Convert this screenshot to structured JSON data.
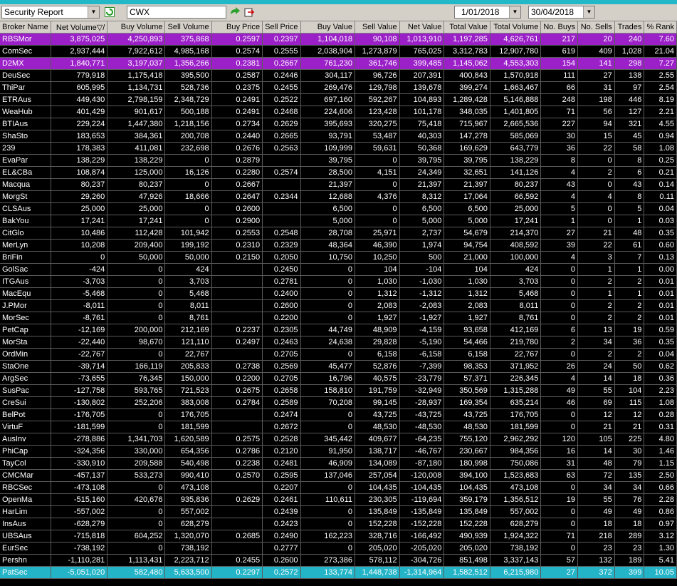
{
  "toolbar": {
    "report_select": "Security Report",
    "code_input": "CWX",
    "date_from": "1/01/2018",
    "date_to": "30/04/2018",
    "icons": [
      "refresh-icon",
      "go-arrow-icon",
      "export-icon"
    ]
  },
  "table": {
    "columns": [
      "Broker Name",
      "Net Volume",
      "Buy Volume",
      "Sell Volume",
      "Buy Price",
      "Sell Price",
      "Buy Value",
      "Sell Value",
      "Net Value",
      "Total Value",
      "Total Volume",
      "No. Buys",
      "No. Sells",
      "Trades",
      "% Rank"
    ],
    "sort_indicator": "▽/",
    "rows": [
      {
        "hl": "purple",
        "cells": [
          "RBSMor",
          "3,875,025",
          "4,250,893",
          "375,868",
          "0.2597",
          "0.2397",
          "1,104,018",
          "90,108",
          "1,013,910",
          "1,197,285",
          "4,626,761",
          "217",
          "20",
          "240",
          "7.60"
        ]
      },
      {
        "hl": "",
        "cells": [
          "ComSec",
          "2,937,444",
          "7,922,612",
          "4,985,168",
          "0.2574",
          "0.2555",
          "2,038,904",
          "1,273,879",
          "765,025",
          "3,312,783",
          "12,907,780",
          "619",
          "409",
          "1,028",
          "21.04"
        ]
      },
      {
        "hl": "purple",
        "cells": [
          "D2MX",
          "1,840,771",
          "3,197,037",
          "1,356,266",
          "0.2381",
          "0.2667",
          "761,230",
          "361,746",
          "399,485",
          "1,145,062",
          "4,553,303",
          "154",
          "141",
          "298",
          "7.27"
        ]
      },
      {
        "hl": "",
        "cells": [
          "DeuSec",
          "779,918",
          "1,175,418",
          "395,500",
          "0.2587",
          "0.2446",
          "304,117",
          "96,726",
          "207,391",
          "400,843",
          "1,570,918",
          "111",
          "27",
          "138",
          "2.55"
        ]
      },
      {
        "hl": "",
        "cells": [
          "ThiPar",
          "605,995",
          "1,134,731",
          "528,736",
          "0.2375",
          "0.2455",
          "269,476",
          "129,798",
          "139,678",
          "399,274",
          "1,663,467",
          "66",
          "31",
          "97",
          "2.54"
        ]
      },
      {
        "hl": "",
        "cells": [
          "ETRAus",
          "449,430",
          "2,798,159",
          "2,348,729",
          "0.2491",
          "0.2522",
          "697,160",
          "592,267",
          "104,893",
          "1,289,428",
          "5,146,888",
          "248",
          "198",
          "446",
          "8.19"
        ]
      },
      {
        "hl": "",
        "cells": [
          "WeaHub",
          "401,429",
          "901,617",
          "500,188",
          "0.2491",
          "0.2468",
          "224,606",
          "123,428",
          "101,178",
          "348,035",
          "1,401,805",
          "71",
          "56",
          "127",
          "2.21"
        ]
      },
      {
        "hl": "",
        "cells": [
          "BTIAus",
          "229,224",
          "1,447,380",
          "1,218,156",
          "0.2734",
          "0.2629",
          "395,693",
          "320,275",
          "75,418",
          "715,967",
          "2,665,536",
          "227",
          "94",
          "321",
          "4.55"
        ]
      },
      {
        "hl": "",
        "cells": [
          "ShaSto",
          "183,653",
          "384,361",
          "200,708",
          "0.2440",
          "0.2665",
          "93,791",
          "53,487",
          "40,303",
          "147,278",
          "585,069",
          "30",
          "15",
          "45",
          "0.94"
        ]
      },
      {
        "hl": "",
        "cells": [
          "239",
          "178,383",
          "411,081",
          "232,698",
          "0.2676",
          "0.2563",
          "109,999",
          "59,631",
          "50,368",
          "169,629",
          "643,779",
          "36",
          "22",
          "58",
          "1.08"
        ]
      },
      {
        "hl": "",
        "cells": [
          "EvaPar",
          "138,229",
          "138,229",
          "0",
          "0.2879",
          "",
          "39,795",
          "0",
          "39,795",
          "39,795",
          "138,229",
          "8",
          "0",
          "8",
          "0.25"
        ]
      },
      {
        "hl": "",
        "cells": [
          "EL&CBa",
          "108,874",
          "125,000",
          "16,126",
          "0.2280",
          "0.2574",
          "28,500",
          "4,151",
          "24,349",
          "32,651",
          "141,126",
          "4",
          "2",
          "6",
          "0.21"
        ]
      },
      {
        "hl": "",
        "cells": [
          "Macqua",
          "80,237",
          "80,237",
          "0",
          "0.2667",
          "",
          "21,397",
          "0",
          "21,397",
          "21,397",
          "80,237",
          "43",
          "0",
          "43",
          "0.14"
        ]
      },
      {
        "hl": "",
        "cells": [
          "MorgSt",
          "29,260",
          "47,926",
          "18,666",
          "0.2647",
          "0.2344",
          "12,688",
          "4,376",
          "8,312",
          "17,064",
          "66,592",
          "4",
          "4",
          "8",
          "0.11"
        ]
      },
      {
        "hl": "",
        "cells": [
          "CLSAus",
          "25,000",
          "25,000",
          "0",
          "0.2600",
          "",
          "6,500",
          "0",
          "6,500",
          "6,500",
          "25,000",
          "5",
          "0",
          "5",
          "0.04"
        ]
      },
      {
        "hl": "",
        "cells": [
          "BakYou",
          "17,241",
          "17,241",
          "0",
          "0.2900",
          "",
          "5,000",
          "0",
          "5,000",
          "5,000",
          "17,241",
          "1",
          "0",
          "1",
          "0.03"
        ]
      },
      {
        "hl": "",
        "cells": [
          "CitGlo",
          "10,486",
          "112,428",
          "101,942",
          "0.2553",
          "0.2548",
          "28,708",
          "25,971",
          "2,737",
          "54,679",
          "214,370",
          "27",
          "21",
          "48",
          "0.35"
        ]
      },
      {
        "hl": "",
        "cells": [
          "MerLyn",
          "10,208",
          "209,400",
          "199,192",
          "0.2310",
          "0.2329",
          "48,364",
          "46,390",
          "1,974",
          "94,754",
          "408,592",
          "39",
          "22",
          "61",
          "0.60"
        ]
      },
      {
        "hl": "",
        "cells": [
          "BriFin",
          "0",
          "50,000",
          "50,000",
          "0.2150",
          "0.2050",
          "10,750",
          "10,250",
          "500",
          "21,000",
          "100,000",
          "4",
          "3",
          "7",
          "0.13"
        ]
      },
      {
        "hl": "",
        "cells": [
          "GolSac",
          "-424",
          "0",
          "424",
          "",
          "0.2450",
          "0",
          "104",
          "-104",
          "104",
          "424",
          "0",
          "1",
          "1",
          "0.00"
        ]
      },
      {
        "hl": "",
        "cells": [
          "ITGAus",
          "-3,703",
          "0",
          "3,703",
          "",
          "0.2781",
          "0",
          "1,030",
          "-1,030",
          "1,030",
          "3,703",
          "0",
          "2",
          "2",
          "0.01"
        ]
      },
      {
        "hl": "",
        "cells": [
          "MacEqu",
          "-5,468",
          "0",
          "5,468",
          "",
          "0.2400",
          "0",
          "1,312",
          "-1,312",
          "1,312",
          "5,468",
          "0",
          "1",
          "1",
          "0.01"
        ]
      },
      {
        "hl": "",
        "cells": [
          "J.PMor",
          "-8,011",
          "0",
          "8,011",
          "",
          "0.2600",
          "0",
          "2,083",
          "-2,083",
          "2,083",
          "8,011",
          "0",
          "2",
          "2",
          "0.01"
        ]
      },
      {
        "hl": "",
        "cells": [
          "MorSec",
          "-8,761",
          "0",
          "8,761",
          "",
          "0.2200",
          "0",
          "1,927",
          "-1,927",
          "1,927",
          "8,761",
          "0",
          "2",
          "2",
          "0.01"
        ]
      },
      {
        "hl": "",
        "cells": [
          "PetCap",
          "-12,169",
          "200,000",
          "212,169",
          "0.2237",
          "0.2305",
          "44,749",
          "48,909",
          "-4,159",
          "93,658",
          "412,169",
          "6",
          "13",
          "19",
          "0.59"
        ]
      },
      {
        "hl": "",
        "cells": [
          "MorSta",
          "-22,440",
          "98,670",
          "121,110",
          "0.2497",
          "0.2463",
          "24,638",
          "29,828",
          "-5,190",
          "54,466",
          "219,780",
          "2",
          "34",
          "36",
          "0.35"
        ]
      },
      {
        "hl": "",
        "cells": [
          "OrdMin",
          "-22,767",
          "0",
          "22,767",
          "",
          "0.2705",
          "0",
          "6,158",
          "-6,158",
          "6,158",
          "22,767",
          "0",
          "2",
          "2",
          "0.04"
        ]
      },
      {
        "hl": "",
        "cells": [
          "StaOne",
          "-39,714",
          "166,119",
          "205,833",
          "0.2738",
          "0.2569",
          "45,477",
          "52,876",
          "-7,399",
          "98,353",
          "371,952",
          "26",
          "24",
          "50",
          "0.62"
        ]
      },
      {
        "hl": "",
        "cells": [
          "ArgSec",
          "-73,655",
          "76,345",
          "150,000",
          "0.2200",
          "0.2705",
          "16,796",
          "40,575",
          "-23,779",
          "57,371",
          "226,345",
          "4",
          "14",
          "18",
          "0.36"
        ]
      },
      {
        "hl": "",
        "cells": [
          "SusPac",
          "-127,758",
          "593,765",
          "721,523",
          "0.2675",
          "0.2658",
          "158,810",
          "191,759",
          "-32,949",
          "350,569",
          "1,315,288",
          "49",
          "55",
          "104",
          "2.23"
        ]
      },
      {
        "hl": "",
        "cells": [
          "CreSui",
          "-130,802",
          "252,206",
          "383,008",
          "0.2784",
          "0.2589",
          "70,208",
          "99,145",
          "-28,937",
          "169,354",
          "635,214",
          "46",
          "69",
          "115",
          "1.08"
        ]
      },
      {
        "hl": "",
        "cells": [
          "BelPot",
          "-176,705",
          "0",
          "176,705",
          "",
          "0.2474",
          "0",
          "43,725",
          "-43,725",
          "43,725",
          "176,705",
          "0",
          "12",
          "12",
          "0.28"
        ]
      },
      {
        "hl": "",
        "cells": [
          "VirtuF",
          "-181,599",
          "0",
          "181,599",
          "",
          "0.2672",
          "0",
          "48,530",
          "-48,530",
          "48,530",
          "181,599",
          "0",
          "21",
          "21",
          "0.31"
        ]
      },
      {
        "hl": "",
        "cells": [
          "AusInv",
          "-278,886",
          "1,341,703",
          "1,620,589",
          "0.2575",
          "0.2528",
          "345,442",
          "409,677",
          "-64,235",
          "755,120",
          "2,962,292",
          "120",
          "105",
          "225",
          "4.80"
        ]
      },
      {
        "hl": "",
        "cells": [
          "PhiCap",
          "-324,356",
          "330,000",
          "654,356",
          "0.2786",
          "0.2120",
          "91,950",
          "138,717",
          "-46,767",
          "230,667",
          "984,356",
          "16",
          "14",
          "30",
          "1.46"
        ]
      },
      {
        "hl": "",
        "cells": [
          "TayCol",
          "-330,910",
          "209,588",
          "540,498",
          "0.2238",
          "0.2481",
          "46,909",
          "134,089",
          "-87,180",
          "180,998",
          "750,086",
          "31",
          "48",
          "79",
          "1.15"
        ]
      },
      {
        "hl": "",
        "cells": [
          "CMCMar",
          "-457,137",
          "533,273",
          "990,410",
          "0.2570",
          "0.2595",
          "137,046",
          "257,054",
          "-120,008",
          "394,100",
          "1,523,683",
          "63",
          "72",
          "135",
          "2.50"
        ]
      },
      {
        "hl": "",
        "cells": [
          "RBCSec",
          "-473,108",
          "0",
          "473,108",
          "",
          "0.2207",
          "0",
          "104,435",
          "-104,435",
          "104,435",
          "473,108",
          "0",
          "34",
          "34",
          "0.66"
        ]
      },
      {
        "hl": "",
        "cells": [
          "OpenMa",
          "-515,160",
          "420,676",
          "935,836",
          "0.2629",
          "0.2461",
          "110,611",
          "230,305",
          "-119,694",
          "359,179",
          "1,356,512",
          "19",
          "55",
          "76",
          "2.28"
        ]
      },
      {
        "hl": "",
        "cells": [
          "HarLim",
          "-557,002",
          "0",
          "557,002",
          "",
          "0.2439",
          "0",
          "135,849",
          "-135,849",
          "135,849",
          "557,002",
          "0",
          "49",
          "49",
          "0.86"
        ]
      },
      {
        "hl": "",
        "cells": [
          "InsAus",
          "-628,279",
          "0",
          "628,279",
          "",
          "0.2423",
          "0",
          "152,228",
          "-152,228",
          "152,228",
          "628,279",
          "0",
          "18",
          "18",
          "0.97"
        ]
      },
      {
        "hl": "",
        "cells": [
          "UBSAus",
          "-715,818",
          "604,252",
          "1,320,070",
          "0.2685",
          "0.2490",
          "162,223",
          "328,716",
          "-166,492",
          "490,939",
          "1,924,322",
          "71",
          "218",
          "289",
          "3.12"
        ]
      },
      {
        "hl": "",
        "cells": [
          "EurSec",
          "-738,192",
          "0",
          "738,192",
          "",
          "0.2777",
          "0",
          "205,020",
          "-205,020",
          "205,020",
          "738,192",
          "0",
          "23",
          "23",
          "1.30"
        ]
      },
      {
        "hl": "",
        "cells": [
          "Pershn",
          "-1,110,281",
          "1,113,431",
          "2,223,712",
          "0.2455",
          "0.2600",
          "273,386",
          "578,112",
          "-304,726",
          "851,498",
          "3,337,143",
          "57",
          "132",
          "189",
          "5.41"
        ]
      },
      {
        "hl": "cyan",
        "cells": [
          "PatSec",
          "-5,051,020",
          "582,480",
          "5,633,500",
          "0.2297",
          "0.2572",
          "133,774",
          "1,448,738",
          "-1,314,964",
          "1,582,512",
          "6,215,980",
          "27",
          "372",
          "399",
          "10.05"
        ]
      }
    ]
  },
  "colors": {
    "grid_bg": "#000000",
    "purple_highlight": "#9b20c8",
    "cyan_highlight": "#23b4c7",
    "header_bg": "#d4d0c8"
  }
}
